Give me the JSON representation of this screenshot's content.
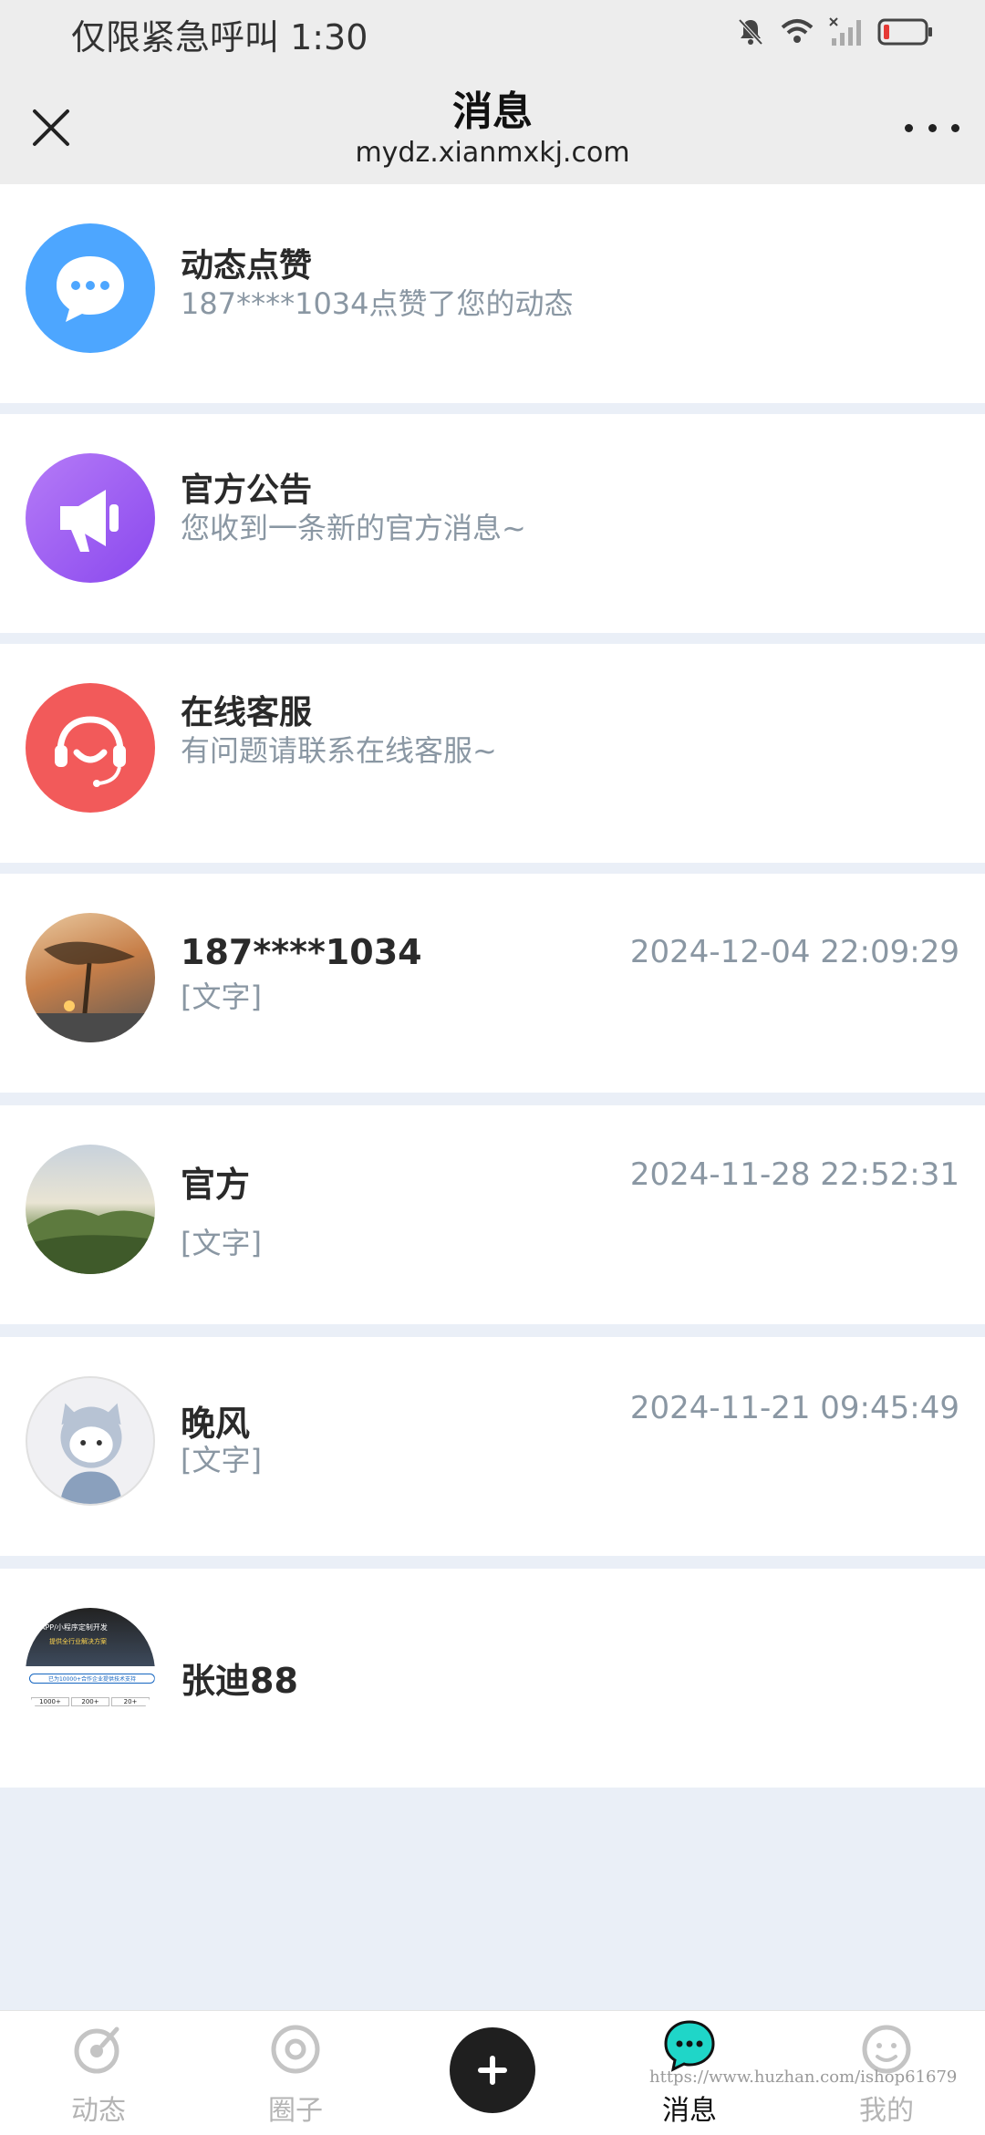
{
  "status_bar": {
    "carrier_text": "仅限紧急呼叫 1:30"
  },
  "header": {
    "title": "消息",
    "url": "mydz.xianmxkj.com",
    "close_icon": "close-icon",
    "more_icon": "more-icon"
  },
  "system_items": [
    {
      "title": "动态点赞",
      "subtitle": "187****1034点赞了您的动态",
      "icon": "chat-bubble-icon",
      "color": "#4da6ff"
    },
    {
      "title": "官方公告",
      "subtitle": "您收到一条新的官方消息~",
      "icon": "megaphone-icon",
      "color": "#9b59f0"
    },
    {
      "title": "在线客服",
      "subtitle": "有问题请联系在线客服~",
      "icon": "customer-service-icon",
      "color": "#f25a5a"
    }
  ],
  "conversations": [
    {
      "name": "187****1034",
      "preview": "[文字]",
      "time": "2024-12-04 22:09:29"
    },
    {
      "name": "官方",
      "preview": "[文字]",
      "time": "2024-11-28 22:52:31"
    },
    {
      "name": "晚风",
      "preview": "[文字]",
      "time": "2024-11-21 09:45:49"
    },
    {
      "name": "张迪88",
      "preview": "",
      "time": "",
      "avatar_text": [
        "APP/小程序定制开发",
        "提供全行业解决方案",
        "已为10000+合作企业提供技术支持",
        "1000+",
        "200+",
        "20+"
      ]
    }
  ],
  "tabbar": {
    "tabs": [
      {
        "label": "动态",
        "icon": "feed-icon",
        "active": false
      },
      {
        "label": "圈子",
        "icon": "circle-icon",
        "active": false
      },
      {
        "label": "",
        "icon": "plus-icon",
        "active": false
      },
      {
        "label": "消息",
        "icon": "message-icon",
        "active": true
      },
      {
        "label": "我的",
        "icon": "profile-icon",
        "active": false
      }
    ]
  },
  "watermark": "https://www.huzhan.com/ishop61679",
  "colors": {
    "accent_teal": "#1fd6c8",
    "subtitle_gray": "#8a97a3",
    "page_bg": "#eaeff7"
  }
}
